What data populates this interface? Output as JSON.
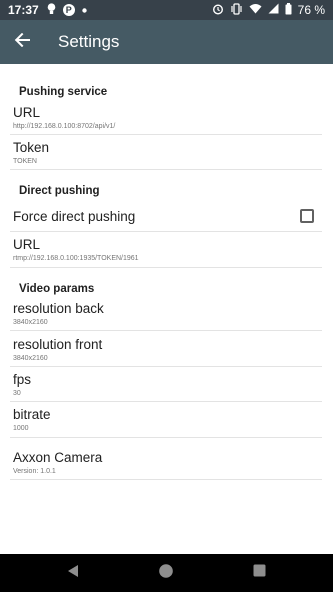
{
  "status_bar": {
    "time": "17:37",
    "battery": "76 %",
    "left_icons": [
      "lightbulb-icon",
      "p-app-icon",
      "dot-icon"
    ],
    "right_icons": [
      "alarm-icon",
      "vibrate-icon",
      "wifi-icon",
      "signal-icon",
      "battery-icon"
    ]
  },
  "app_bar": {
    "title": "Settings"
  },
  "sections": {
    "pushing_service": {
      "header": "Pushing service",
      "url_title": "URL",
      "url_value": "http://192.168.0.100:8702/api/v1/",
      "token_title": "Token",
      "token_value": "TOKEN"
    },
    "direct_pushing": {
      "header": "Direct pushing",
      "force_title": "Force direct pushing",
      "force_checked": false,
      "url_title": "URL",
      "url_value": "rtmp://192.168.0.100:1935/TOKEN/1961"
    },
    "video_params": {
      "header": "Video params",
      "res_back_title": "resolution back",
      "res_back_value": "3840x2160",
      "res_front_title": "resolution front",
      "res_front_value": "3840x2160",
      "fps_title": "fps",
      "fps_value": "30",
      "bitrate_title": "bitrate",
      "bitrate_value": "1000"
    },
    "about": {
      "title": "Axxon Camera",
      "version": "Version: 1.0.1"
    }
  },
  "nav_bar": {
    "buttons": [
      "back-triangle-icon",
      "home-circle-icon",
      "recents-square-icon"
    ]
  }
}
